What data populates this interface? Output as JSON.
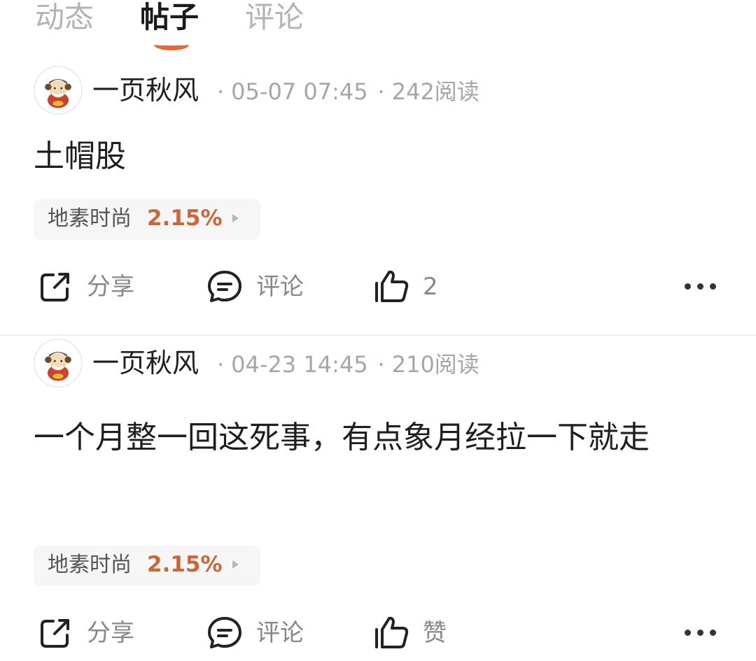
{
  "tabs": [
    {
      "label": "动态",
      "active": false
    },
    {
      "label": "帖子",
      "active": true
    },
    {
      "label": "评论",
      "active": false
    }
  ],
  "accent_color": "#e8692d",
  "stock_change_color": "#c9663a",
  "posts": [
    {
      "author": "一页秋风",
      "dot": "·",
      "time": "05-07 07:45",
      "reads": "242阅读",
      "text": "土帽股",
      "stock": {
        "name": "地素时尚",
        "change": "2.15%"
      },
      "actions": {
        "share": "分享",
        "comment": "评论",
        "like": "2"
      }
    },
    {
      "author": "一页秋风",
      "dot": "·",
      "time": "04-23 14:45",
      "reads": "210阅读",
      "text": "一个月整一回这死事，有点象月经拉一下就走",
      "stock": {
        "name": "地素时尚",
        "change": "2.15%"
      },
      "actions": {
        "share": "分享",
        "comment": "评论",
        "like": "赞"
      }
    }
  ],
  "icons": {
    "share": "share-icon",
    "comment": "comment-icon",
    "like": "thumbs-up-icon",
    "more": "more-icon"
  }
}
